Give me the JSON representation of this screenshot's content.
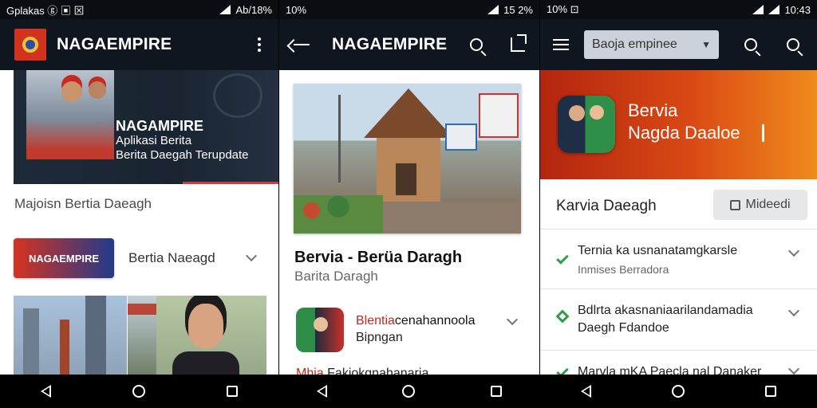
{
  "screen1": {
    "status": {
      "left": "Gplakas ⓖ ▣ ⊠",
      "right": "Ab/18%"
    },
    "appbar": {
      "title": "NAGAEMPIRE"
    },
    "banner": {
      "title": "NAGAMPIRE",
      "line2": "Aplikasi Berita",
      "line3": "Berita Daegah Terupdate"
    },
    "section_label": "Majoisn Bertia Daeagh",
    "brand_card": "NAGAEMPIRE",
    "brand_select": "Bertia Naeagd"
  },
  "screen2": {
    "status": {
      "left": "10%",
      "right": "15 2%"
    },
    "appbar": {
      "title": "NAGAEMPIRE"
    },
    "headline": "Bervia - Berüa Daragh",
    "subhead": "Barita Daragh",
    "row1": {
      "line1_red": "Blentia",
      "line1_rest": "cenahannoola",
      "line2": "Bipngan"
    },
    "row2": {
      "line1_red": "Mhia",
      "line1_rest": "Fakiokgnahanaria"
    }
  },
  "screen3": {
    "status": {
      "left": "10% ⊡",
      "right": "10:43"
    },
    "dropdown": "Baoja empinee",
    "header": {
      "line1": "Bervia",
      "line2": "Nagda Daaloe"
    },
    "section_title": "Karvia Daeagh",
    "button": "Mideedi",
    "items": [
      {
        "line1": "Ternia ka usnanatamgkarsle",
        "line2": "Inmises Berradora"
      },
      {
        "line1": "Bdlrta akasnaniaarilandamadia",
        "line2": "Daegh Fdandoe"
      },
      {
        "line1": "Marvla mKA Paecla nal Danaker",
        "line2": ""
      }
    ]
  },
  "colors": {
    "appbar": "#10161f",
    "accent_red": "#c4281c",
    "accent_green": "#2e9e49",
    "header_orange": "#d94a14"
  }
}
